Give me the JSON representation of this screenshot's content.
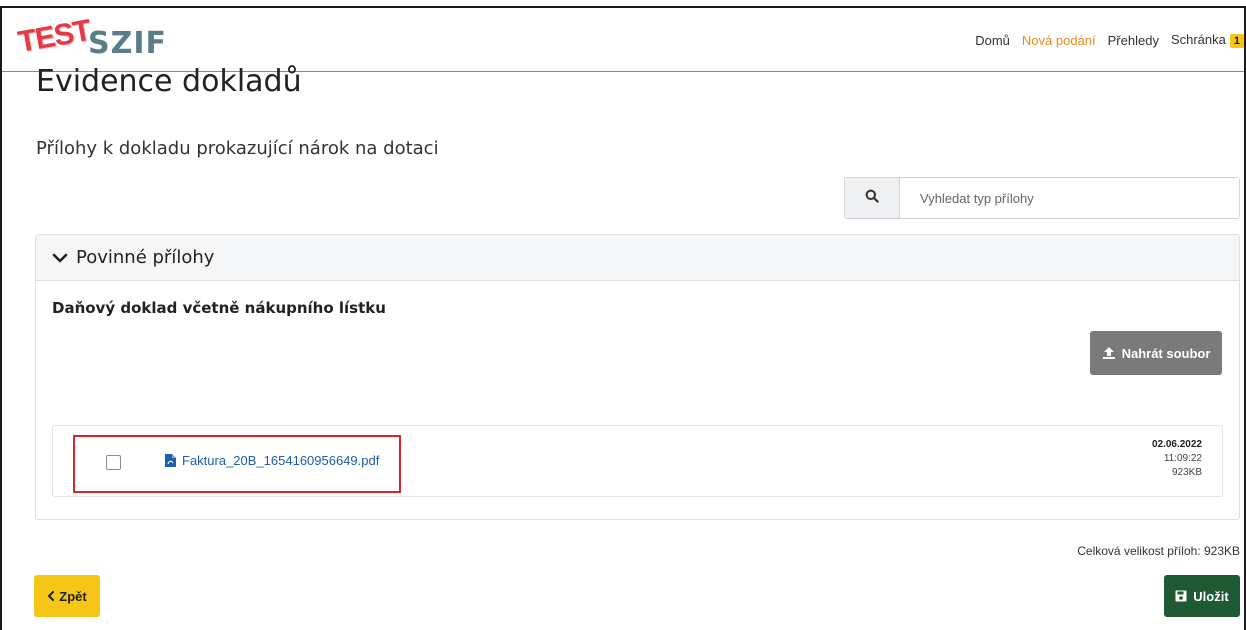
{
  "header": {
    "logo_test": "TEST",
    "logo_brand": "SZIF",
    "nav": {
      "home": "Domů",
      "new_submissions": "Nová podání",
      "overviews": "Přehledy",
      "inbox": "Schránka",
      "inbox_count": "1"
    }
  },
  "page": {
    "title": "Evidence dokladů",
    "subtitle": "Přílohy k dokladu prokazující nárok na dotaci"
  },
  "search": {
    "placeholder": "Vyhledat typ přílohy",
    "value": ""
  },
  "panel": {
    "header": "Povinné přílohy",
    "section_title": "Daňový doklad včetně nákupního lístku",
    "upload_label": "Nahrát soubor",
    "files": [
      {
        "name": "Faktura_20B_1654160956649.pdf",
        "date": "02.06.2022",
        "time": "11:09:22",
        "size": "923KB"
      }
    ]
  },
  "footer": {
    "total": "Celková velikost příloh: 923KB",
    "back_label": "Zpět",
    "save_label": "Uložit"
  },
  "colors": {
    "nav_active": "#e38c1f",
    "badge": "#f5c518",
    "back_button": "#f5c518",
    "save_button": "#1f5a35",
    "upload_button": "#7a7a7a",
    "highlight_border": "#d9232d",
    "link": "#1f5ea8"
  },
  "icons": {
    "search": "search-icon",
    "chevron": "chevron-down-icon",
    "upload": "upload-icon",
    "pdf": "pdf-file-icon",
    "back": "chevron-left-icon",
    "save": "floppy-disk-icon"
  }
}
